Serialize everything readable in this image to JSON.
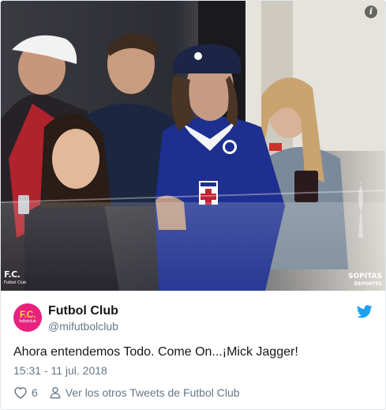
{
  "media": {
    "watermark_left": "F.C.",
    "watermark_left_sub": "Futbol Club",
    "watermark_right": "SOPITAS",
    "watermark_right_sub": "DEPORTES",
    "jersey_badge_text": "DEPORTIVO",
    "info_glyph": "i"
  },
  "tweet": {
    "avatar_text": "F.C.",
    "avatar_subtext": "futbolclub",
    "display_name": "Futbol Club",
    "handle": "@mifutbolclub",
    "text": "Ahora entendemos Todo. Come On...¡Mick Jagger!",
    "timestamp": "15:31 - 11 jul. 2018",
    "like_count": "6",
    "more_tweets_label": "Ver los otros Tweets de Futbol Club"
  },
  "colors": {
    "brand_blue": "#1da1f2",
    "muted_text": "#657786",
    "avatar_bg": "#e8217f",
    "jersey_blue": "#1d2f8f"
  },
  "icons": {
    "info": "info-icon",
    "bird": "twitter-bird-icon",
    "heart": "heart-icon",
    "person": "person-icon"
  }
}
